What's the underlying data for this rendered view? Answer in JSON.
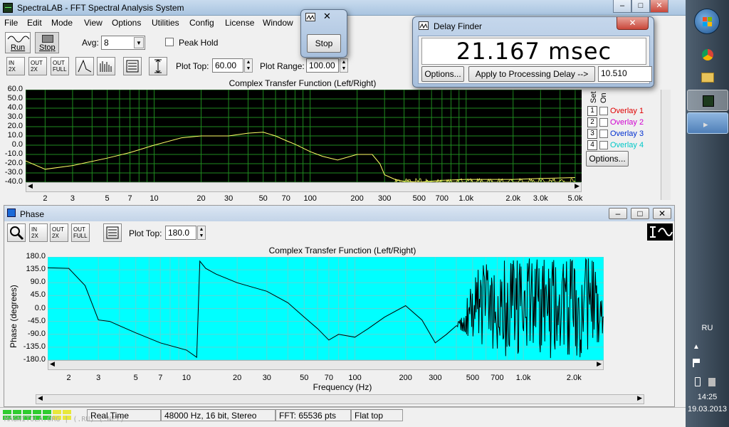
{
  "app": {
    "title": "SpectraLAB - FFT Spectral Analysis System",
    "watermark": "MAGNITOLA.ORG | (.RU) (.NET)"
  },
  "menu": [
    "File",
    "Edit",
    "Mode",
    "View",
    "Options",
    "Utilities",
    "Config",
    "License",
    "Window"
  ],
  "toolbar": {
    "run_label": "Run",
    "stop_label": "Stop",
    "avg_label": "Avg:",
    "avg_value": "8",
    "peak_hold_label": "Peak Hold",
    "plot_top_label": "Plot Top:",
    "plot_top_value": "60.00",
    "plot_range_label": "Plot Range:",
    "plot_range_value": "100.00"
  },
  "stop_popup": {
    "label": "Stop"
  },
  "delay_finder": {
    "title": "Delay Finder",
    "readout": "21.167 msec",
    "options_label": "Options...",
    "apply_label": "Apply to Processing Delay -->",
    "delay_value": "10.510"
  },
  "magnitude_chart": {
    "title": "Complex Transfer Function (Left/Right)",
    "y_ticks": [
      "60.0",
      "50.0",
      "40.0",
      "30.0",
      "20.0",
      "10.0",
      "0.0",
      "-10.0",
      "-20.0",
      "-30.0",
      "-40.0"
    ],
    "x_ticks": [
      "2",
      "3",
      "5",
      "7",
      "10",
      "20",
      "30",
      "50",
      "70",
      "100",
      "200",
      "300",
      "500",
      "700",
      "1.0k",
      "2.0k",
      "3.0k",
      "5.0k"
    ],
    "set_label": "Set",
    "on_label": "On",
    "overlays": [
      {
        "num": "1",
        "label": "Overlay 1",
        "color": "#e00000"
      },
      {
        "num": "2",
        "label": "Overlay 2",
        "color": "#d000d0"
      },
      {
        "num": "3",
        "label": "Overlay 3",
        "color": "#0030d0"
      },
      {
        "num": "4",
        "label": "Overlay 4",
        "color": "#00c8c8"
      }
    ],
    "options_label": "Options...",
    "trace_color": "#ffff66"
  },
  "phase_window": {
    "title": "Phase",
    "plot_top_label": "Plot Top:",
    "plot_top_value": "180.0",
    "chart_title": "Complex Transfer Function (Left/Right)",
    "y_label": "Phase (degrees)",
    "x_label": "Frequency (Hz)",
    "y_ticks": [
      "180.0",
      "135.0",
      "90.0",
      "45.0",
      "0.0",
      "-45.0",
      "-90.0",
      "-135.0",
      "-180.0"
    ],
    "x_ticks": [
      "2",
      "3",
      "5",
      "7",
      "10",
      "20",
      "30",
      "50",
      "70",
      "100",
      "200",
      "300",
      "500",
      "700",
      "1.0k",
      "2.0k"
    ],
    "bg_color": "#00ffff"
  },
  "chart_data": [
    {
      "type": "line",
      "title": "Complex Transfer Function (Left/Right)",
      "xlabel": "",
      "ylabel": "",
      "x_scale": "log",
      "ylim": [
        -40,
        60
      ],
      "series": [
        {
          "x": [
            1.5,
            2,
            3,
            5,
            7,
            10,
            15,
            20,
            30,
            40,
            50,
            60,
            70,
            80,
            100,
            120,
            150,
            200,
            250,
            280,
            300,
            350,
            400,
            500,
            700,
            1000,
            2000,
            3000,
            5000
          ],
          "values": [
            -17,
            -26,
            -22,
            -14,
            -8,
            0,
            8,
            10,
            10,
            13,
            14,
            10,
            5,
            1,
            -7,
            -12,
            -16,
            -10,
            -10,
            -20,
            -32,
            -37,
            -39,
            -40,
            -38,
            -37,
            -37,
            -36,
            -35
          ]
        }
      ]
    },
    {
      "type": "line",
      "title": "Complex Transfer Function (Left/Right)",
      "xlabel": "Frequency (Hz)",
      "ylabel": "Phase (degrees)",
      "x_scale": "log",
      "ylim": [
        -180,
        180
      ],
      "series": [
        {
          "x": [
            1.5,
            2,
            2.5,
            3,
            3.5,
            4,
            5,
            7,
            10,
            11.5,
            12,
            13,
            15,
            20,
            30,
            40,
            50,
            60,
            70,
            80,
            100,
            120,
            150,
            200,
            250,
            300,
            350,
            400
          ],
          "values": [
            142,
            140,
            80,
            -40,
            -45,
            -60,
            -85,
            -120,
            -145,
            -170,
            165,
            140,
            120,
            90,
            60,
            20,
            -30,
            -70,
            -110,
            -90,
            -100,
            -70,
            -30,
            10,
            -40,
            -120,
            -90,
            -60
          ]
        }
      ]
    }
  ],
  "status": {
    "mode": "Real Time",
    "format": "48000 Hz, 16 bit, Stereo",
    "fft": "FFT: 65536 pts",
    "window": "Flat top"
  },
  "taskbar": {
    "lang": "RU",
    "time": "14:25",
    "date": "19.03.2013"
  }
}
